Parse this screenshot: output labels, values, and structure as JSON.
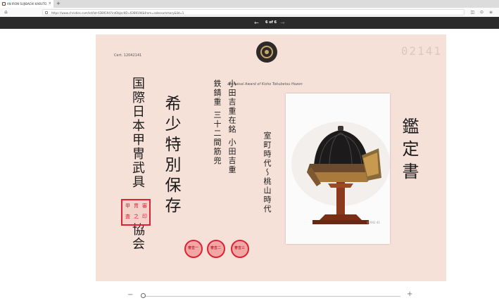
{
  "browser": {
    "tab_title": "AN IRON SUJIBACHI KABUTO",
    "tab_close": "×",
    "new_tab": "+",
    "url": "https://www.christies.com/lot/lot-6389194?intObjectID=6389194&from=salessummary&lid=1",
    "home_icon": "home-icon",
    "toolbar_icons": "◫ ⊙ ≡"
  },
  "viewer": {
    "prev_label": "←",
    "counter": "6 of 6",
    "next_label": "→"
  },
  "document": {
    "cert_label": "Cert. 12042141",
    "cert_number_stamp": "02141",
    "title": "Appraisal Award of Kisho Tokubetsu Hozon",
    "assoc_name": "国際日本甲冑武具",
    "assoc_tail": "協会",
    "grade": "希少特別保存",
    "line1": "鉄錆重 三十二間筋兜",
    "line2": "小田吉重在銘 小田吉重",
    "period": "室町時代〜桃山時代",
    "heading": "鑑定書",
    "photo_caption": "02942 41",
    "seal_chars": [
      "甲",
      "冑",
      "審",
      "査",
      "之",
      "印"
    ],
    "round_seals": [
      "審査一",
      "審査二",
      "審査三"
    ]
  },
  "zoom": {
    "minus": "−",
    "plus": "+",
    "level": 0.0
  },
  "colors": {
    "paper": "#f6e1d9",
    "seal_red": "#dd2233",
    "viewer_bar": "#2b2b2b"
  }
}
